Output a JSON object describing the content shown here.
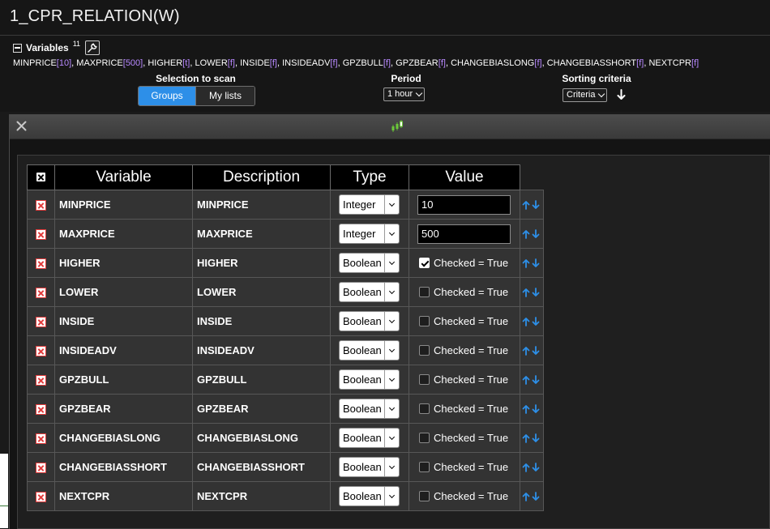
{
  "page": {
    "title": "1_CPR_RELATION(W)"
  },
  "variables_header": {
    "label": "Variables",
    "count": "11"
  },
  "variable_summary": [
    {
      "name": "MINPRICE",
      "value": "10"
    },
    {
      "name": "MAXPRICE",
      "value": "500"
    },
    {
      "name": "HIGHER",
      "value": "t"
    },
    {
      "name": "LOWER",
      "value": "f"
    },
    {
      "name": "INSIDE",
      "value": "f"
    },
    {
      "name": "INSIDEADV",
      "value": "f"
    },
    {
      "name": "GPZBULL",
      "value": "f"
    },
    {
      "name": "GPZBEAR",
      "value": "f"
    },
    {
      "name": "CHANGEBIASLONG",
      "value": "f"
    },
    {
      "name": "CHANGEBIASSHORT",
      "value": "f"
    },
    {
      "name": "NEXTCPR",
      "value": "f"
    }
  ],
  "controls": {
    "selection_label": "Selection to scan",
    "selection_tabs": [
      "Groups",
      "My lists"
    ],
    "period_label": "Period",
    "period_value": "1 hour",
    "sorting_label": "Sorting criteria",
    "sorting_value": "Criteria"
  },
  "table": {
    "headers": [
      "Variable",
      "Description",
      "Type",
      "Value"
    ],
    "rows": [
      {
        "variable": "MINPRICE",
        "description": "MINPRICE",
        "type": "Integer",
        "value": "10"
      },
      {
        "variable": "MAXPRICE",
        "description": "MAXPRICE",
        "type": "Integer",
        "value": "500"
      },
      {
        "variable": "HIGHER",
        "description": "HIGHER",
        "type": "Boolean",
        "checked": true,
        "value": "Checked = True"
      },
      {
        "variable": "LOWER",
        "description": "LOWER",
        "type": "Boolean",
        "checked": false,
        "value": "Checked = True"
      },
      {
        "variable": "INSIDE",
        "description": "INSIDE",
        "type": "Boolean",
        "checked": false,
        "value": "Checked = True"
      },
      {
        "variable": "INSIDEADV",
        "description": "INSIDEADV",
        "type": "Boolean",
        "checked": false,
        "value": "Checked = True"
      },
      {
        "variable": "GPZBULL",
        "description": "GPZBULL",
        "type": "Boolean",
        "checked": false,
        "value": "Checked = True"
      },
      {
        "variable": "GPZBEAR",
        "description": "GPZBEAR",
        "type": "Boolean",
        "checked": false,
        "value": "Checked = True"
      },
      {
        "variable": "CHANGEBIASLONG",
        "description": "CHANGEBIASLONG",
        "type": "Boolean",
        "checked": false,
        "value": "Checked = True"
      },
      {
        "variable": "CHANGEBIASSHORT",
        "description": "CHANGEBIASSHORT",
        "type": "Boolean",
        "checked": false,
        "value": "Checked = True"
      },
      {
        "variable": "NEXTCPR",
        "description": "NEXTCPR",
        "type": "Boolean",
        "checked": false,
        "value": "Checked = True"
      }
    ]
  },
  "icons": {
    "collapse": "minus-box-icon",
    "edit": "wrench-icon",
    "sort_direction": "arrow-down-icon",
    "dialog_close": "close-icon",
    "dialog_logo": "candlestick-icon",
    "header_clear": "clear-all-icon",
    "row_remove": "remove-icon",
    "row_move": "move-up-down-icon"
  },
  "colors": {
    "accent_blue": "#2d8fe8",
    "value_purple": "#b889ff",
    "remove_red": "#e23b3b",
    "logo_green": "#6cc83a"
  }
}
